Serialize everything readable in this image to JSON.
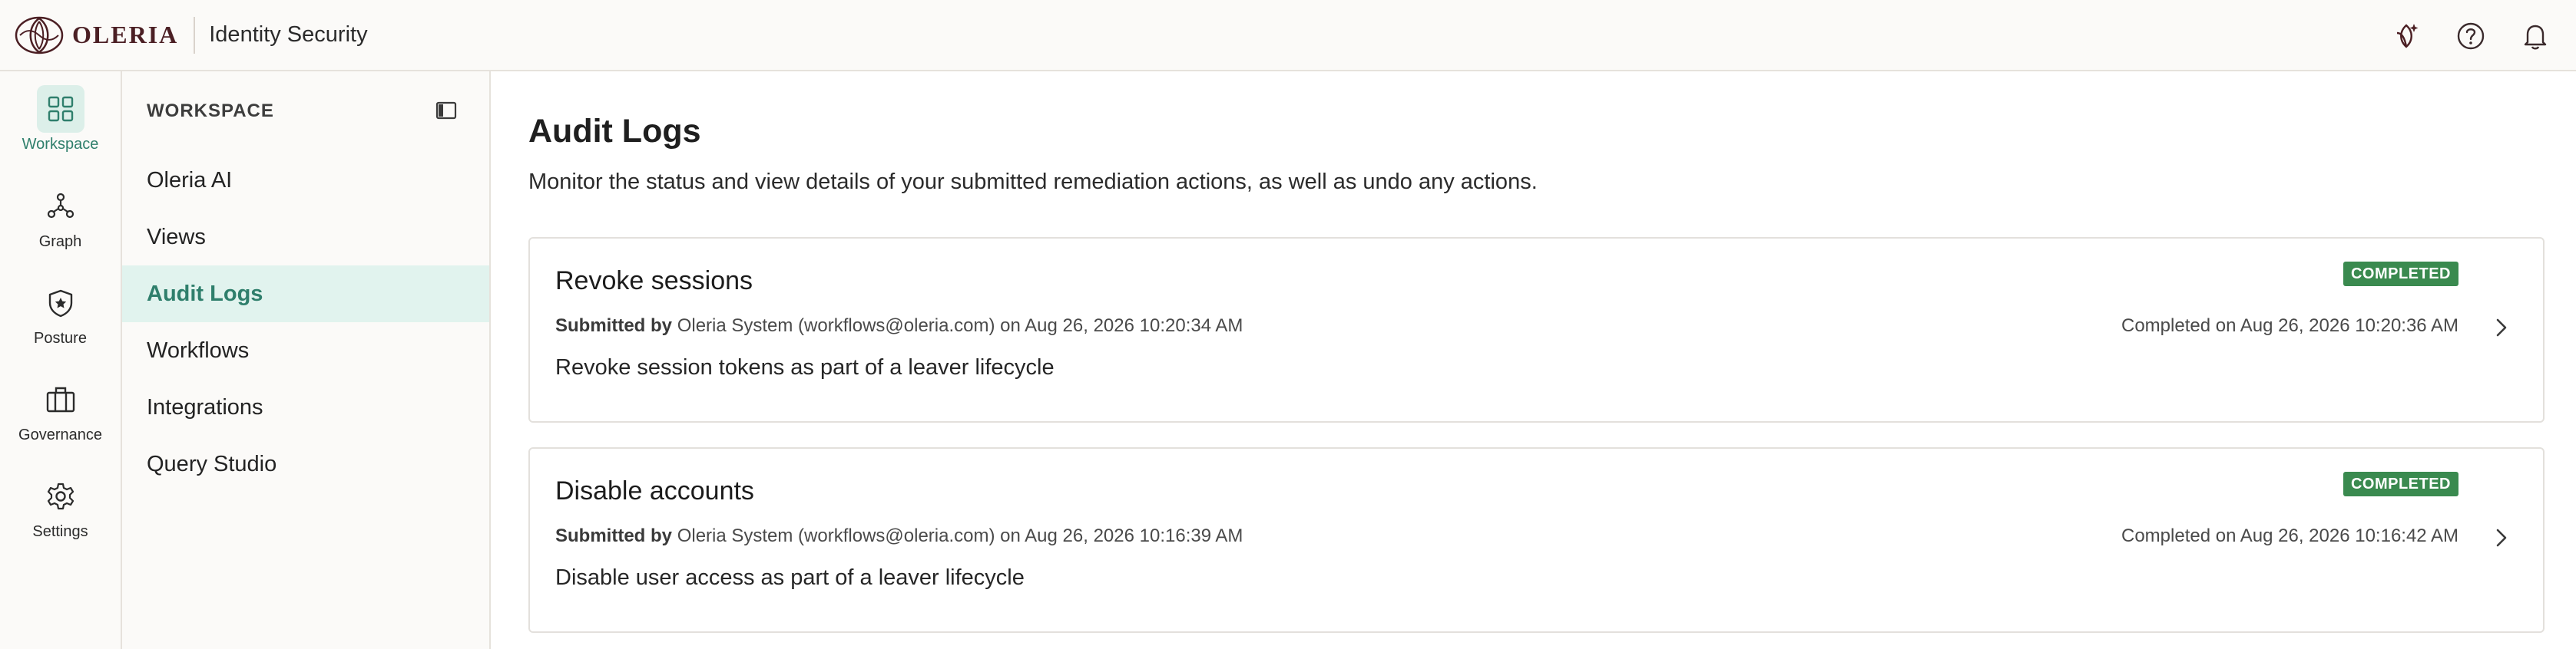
{
  "header": {
    "brand_name": "OLERIA",
    "product_name": "Identity Security",
    "icons": [
      "ai-assistant-icon",
      "help-icon",
      "bell-icon"
    ]
  },
  "rail": {
    "items": [
      {
        "label": "Workspace",
        "icon": "grid-icon",
        "active": true
      },
      {
        "label": "Graph",
        "icon": "graph-nodes-icon",
        "active": false
      },
      {
        "label": "Posture",
        "icon": "shield-star-icon",
        "active": false
      },
      {
        "label": "Governance",
        "icon": "briefcase-icon",
        "active": false
      },
      {
        "label": "Settings",
        "icon": "gear-icon",
        "active": false
      }
    ]
  },
  "sidebar": {
    "heading": "WORKSPACE",
    "items": [
      {
        "label": "Oleria AI",
        "active": false
      },
      {
        "label": "Views",
        "active": false
      },
      {
        "label": "Audit Logs",
        "active": true
      },
      {
        "label": "Workflows",
        "active": false
      },
      {
        "label": "Integrations",
        "active": false
      },
      {
        "label": "Query Studio",
        "active": false
      }
    ]
  },
  "main": {
    "title": "Audit Logs",
    "description": "Monitor the status and view details of your submitted remediation actions, as well as undo any actions.",
    "cards": [
      {
        "title": "Revoke sessions",
        "status": "COMPLETED",
        "submitted_label": "Submitted by",
        "submitted_text": "Oleria System (workflows@oleria.com) on Aug 26, 2026 10:20:34 AM",
        "completed_text": "Completed on Aug 26, 2026 10:20:36 AM",
        "description": "Revoke session tokens as part of a leaver lifecycle"
      },
      {
        "title": "Disable accounts",
        "status": "COMPLETED",
        "submitted_label": "Submitted by",
        "submitted_text": "Oleria System (workflows@oleria.com) on Aug 26, 2026 10:16:39 AM",
        "completed_text": "Completed on Aug 26, 2026 10:16:42 AM",
        "description": "Disable user access as part of a leaver lifecycle"
      }
    ]
  },
  "colors": {
    "accent": "#2f7f6c",
    "accent_bg": "#e1f3ee",
    "badge_green": "#3a8a4f",
    "brand": "#4b1f24"
  }
}
